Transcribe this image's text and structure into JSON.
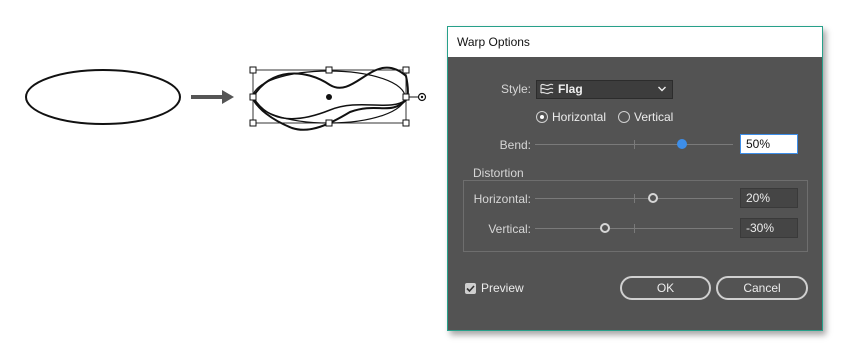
{
  "dialog": {
    "title": "Warp Options",
    "style": {
      "label": "Style:",
      "value": "Flag",
      "icon": "flag-warp-icon"
    },
    "orientation": {
      "horizontal_label": "Horizontal",
      "vertical_label": "Vertical",
      "selected": "Horizontal"
    },
    "bend": {
      "label": "Bend:",
      "value": "50%",
      "level": 0.5
    },
    "distortion": {
      "group_label": "Distortion",
      "horizontal": {
        "label": "Horizontal:",
        "value": "20%",
        "level": 0.2
      },
      "vertical": {
        "label": "Vertical:",
        "value": "-30%",
        "level": -0.3
      }
    },
    "preview": {
      "label": "Preview",
      "checked": true
    },
    "ok_label": "OK",
    "cancel_label": "Cancel"
  },
  "colors": {
    "dialog_bg": "#535353",
    "accent_blue": "#3d8ee9",
    "border_teal": "#27a08a"
  }
}
